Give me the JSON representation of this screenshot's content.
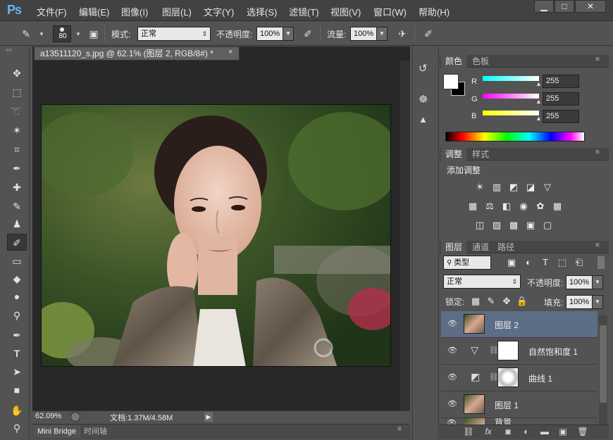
{
  "app": {
    "logo": "Ps"
  },
  "menu": [
    "文件(F)",
    "编辑(E)",
    "图像(I)",
    "图层(L)",
    "文字(Y)",
    "选择(S)",
    "滤镜(T)",
    "视图(V)",
    "窗口(W)",
    "帮助(H)"
  ],
  "window_controls": {
    "minimize": "▁",
    "maximize": "□",
    "close": "✕"
  },
  "options": {
    "brush_size": "80",
    "mode_label": "模式:",
    "mode_value": "正常",
    "opacity_label": "不透明度:",
    "opacity_value": "100%",
    "flow_label": "流量:",
    "flow_value": "100%"
  },
  "document": {
    "tab_title": "a13511120_s.jpg @ 62.1% (图层 2, RGB/8#) *",
    "zoom": "62.09%",
    "doc_info": "文档:1.37M/4.58M"
  },
  "bottom_tabs": [
    "Mini Bridge",
    "时间轴"
  ],
  "color_panel": {
    "tabs": [
      "颜色",
      "色板"
    ],
    "channels": [
      {
        "label": "R",
        "value": "255"
      },
      {
        "label": "G",
        "value": "255"
      },
      {
        "label": "B",
        "value": "255"
      }
    ]
  },
  "adjust_panel": {
    "tabs": [
      "调整",
      "样式"
    ],
    "title": "添加调整"
  },
  "layers_panel": {
    "tabs": [
      "图层",
      "通道",
      "路径"
    ],
    "filter_value": "类型",
    "blend_value": "正常",
    "opacity_label": "不透明度:",
    "opacity_value": "100%",
    "lock_label": "锁定:",
    "fill_label": "填充:",
    "fill_value": "100%",
    "layers": [
      {
        "name": "图层 2"
      },
      {
        "name": "自然饱和度 1"
      },
      {
        "name": "曲线 1"
      },
      {
        "name": "图层 1"
      },
      {
        "name": "背景"
      }
    ]
  },
  "colors": {
    "accent_selection": "#5d6d86",
    "logo_blue": "#6ab1ef"
  }
}
